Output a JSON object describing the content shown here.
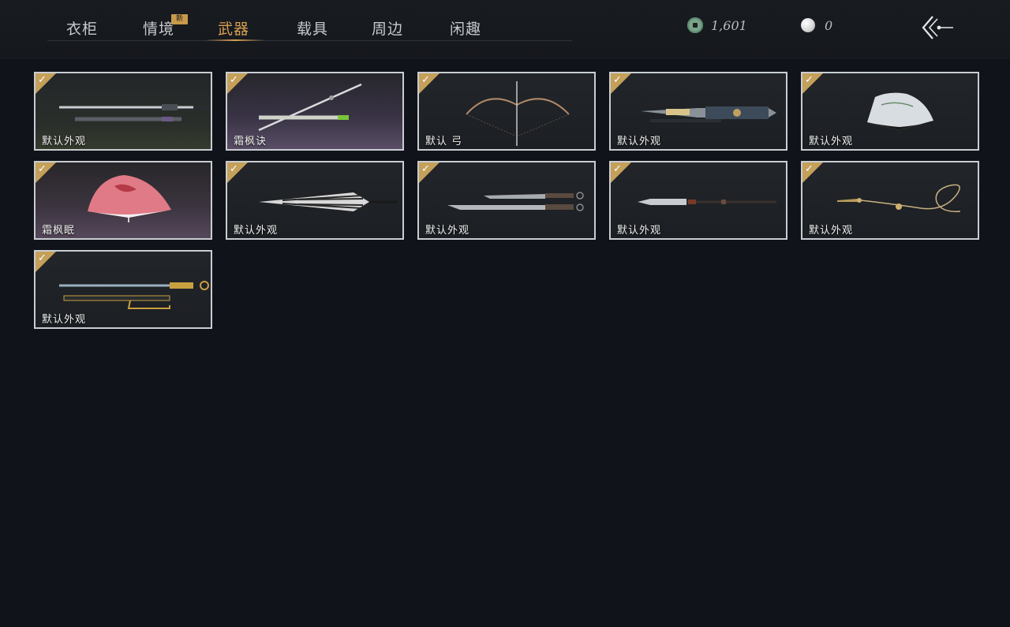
{
  "tabs": [
    {
      "label": "衣柜"
    },
    {
      "label": "情境",
      "badge": "新"
    },
    {
      "label": "武器"
    },
    {
      "label": "载具"
    },
    {
      "label": "周边"
    },
    {
      "label": "闲趣"
    }
  ],
  "active_tab": "武器",
  "currency": {
    "jade": {
      "icon": "jade-coin-icon",
      "value": "1,601"
    },
    "pearl": {
      "icon": "pearl-icon",
      "value": "0"
    }
  },
  "back": {
    "icon": "back-arrow-icon"
  },
  "colors": {
    "accent": "#d8a052",
    "check_corner": "#c4a05a",
    "card_border": "#c9cdd2",
    "background": "#10141a"
  },
  "items": [
    {
      "label": "默认外观",
      "icon": "twin-sword-icon",
      "selected": true
    },
    {
      "label": "霜枫诀",
      "icon": "long-sword-icon",
      "selected": true
    },
    {
      "label": "默认 弓",
      "icon": "bow-icon",
      "selected": true
    },
    {
      "label": "默认外观",
      "icon": "gun-blade-icon",
      "selected": true
    },
    {
      "label": "默认外观",
      "icon": "white-fan-icon",
      "selected": true
    },
    {
      "label": "霜枫眠",
      "icon": "red-fan-icon",
      "selected": true
    },
    {
      "label": "默认外观",
      "icon": "umbrella-icon",
      "selected": true
    },
    {
      "label": "默认外观",
      "icon": "dual-blades-icon",
      "selected": true
    },
    {
      "label": "默认外观",
      "icon": "spear-icon",
      "selected": true
    },
    {
      "label": "默认外观",
      "icon": "rope-dart-icon",
      "selected": true
    },
    {
      "label": "默认外观",
      "icon": "katana-icon",
      "selected": true
    }
  ]
}
